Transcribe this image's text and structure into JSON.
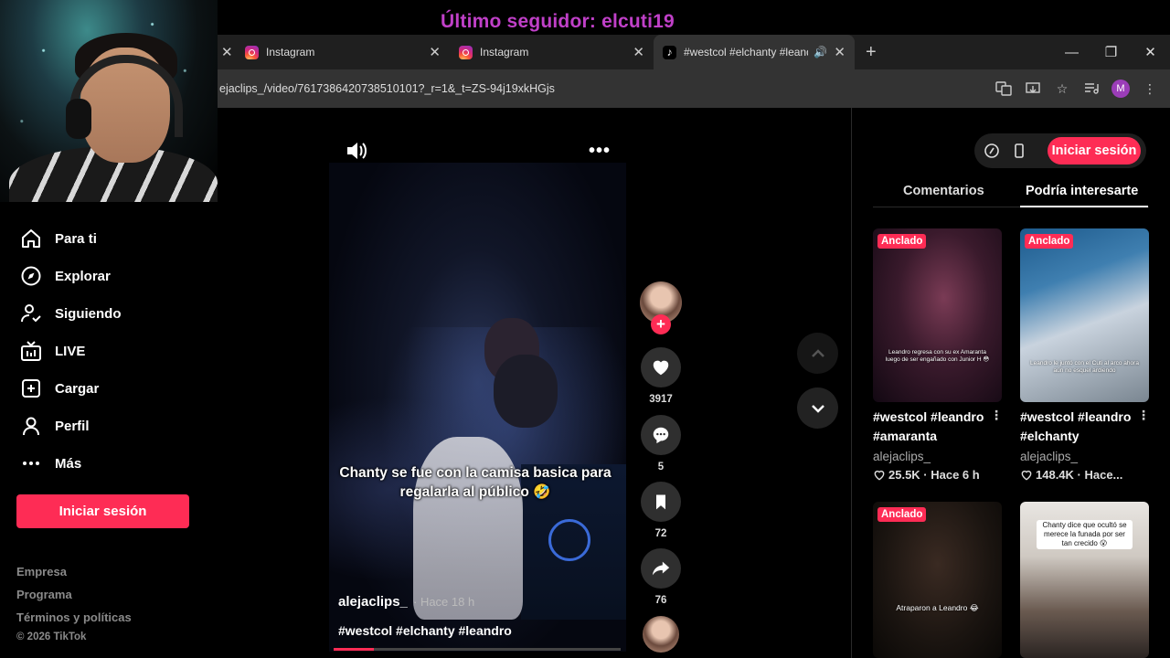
{
  "overlay": {
    "text": "Último seguidor: elcuti19"
  },
  "browser": {
    "tabs": [
      {
        "title": "Instagram",
        "favicon": "instagram-icon"
      },
      {
        "title": "Instagram",
        "favicon": "instagram-icon"
      },
      {
        "title": "#westcol #elchanty #leandr",
        "favicon": "tiktok-icon",
        "active": true
      }
    ],
    "url": "ejaclips_/video/7617386420738510101?_r=1&_t=ZS-94j19xkHGjs",
    "profile_initial": "M"
  },
  "sidebar": {
    "items": [
      {
        "label": "Para ti",
        "icon": "home-icon"
      },
      {
        "label": "Explorar",
        "icon": "compass-icon"
      },
      {
        "label": "Siguiendo",
        "icon": "following-icon"
      },
      {
        "label": "LIVE",
        "icon": "live-icon"
      },
      {
        "label": "Cargar",
        "icon": "upload-icon"
      },
      {
        "label": "Perfil",
        "icon": "profile-icon"
      },
      {
        "label": "Más",
        "icon": "more-icon"
      }
    ],
    "login_label": "Iniciar sesión",
    "footer": [
      "Empresa",
      "Programa",
      "Términos y políticas",
      "© 2026 TikTok"
    ]
  },
  "video": {
    "caption": "Chanty se fue con la camisa basica para regalarla al público 🤣",
    "author": "alejaclips_",
    "time": "· Hace 18 h",
    "hashtags": "#westcol #elchanty #leandro",
    "progress": 0.14,
    "likes": "3917",
    "comments": "5",
    "saves": "72",
    "shares": "76"
  },
  "right_panel": {
    "login_label": "Iniciar sesión",
    "tabs": [
      {
        "label": "Comentarios",
        "active": false
      },
      {
        "label": "Podría interesarte",
        "active": true
      }
    ],
    "cards": [
      {
        "pin": "Anclado",
        "thumb_caption": "Leandro regresa con su ex Amaranta luego de ser engañado con Junior H 😳",
        "title": "#westcol #leandro #amaranta",
        "author": "alejaclips_",
        "stats": "25.5K · Hace 6 h"
      },
      {
        "pin": "Anclado",
        "thumb_caption": "Leandro le juntó con el Cuti al arco ahora aún no esquel ardiendo",
        "title": "#westcol #leandro #elchanty",
        "author": "alejaclips_",
        "stats": "148.4K · Hace..."
      },
      {
        "pin": "Anclado",
        "thumb_caption": "Atraparon a Leandro 😂",
        "title": "",
        "author": "",
        "stats": ""
      },
      {
        "pin": "",
        "thumb_caption": "Chanty dice que ocultó se merece la funada por ser tan crecido 😮",
        "title": "",
        "author": "",
        "stats": ""
      }
    ]
  },
  "colors": {
    "accent": "#fe2c55",
    "overlay": "#c040c8"
  }
}
